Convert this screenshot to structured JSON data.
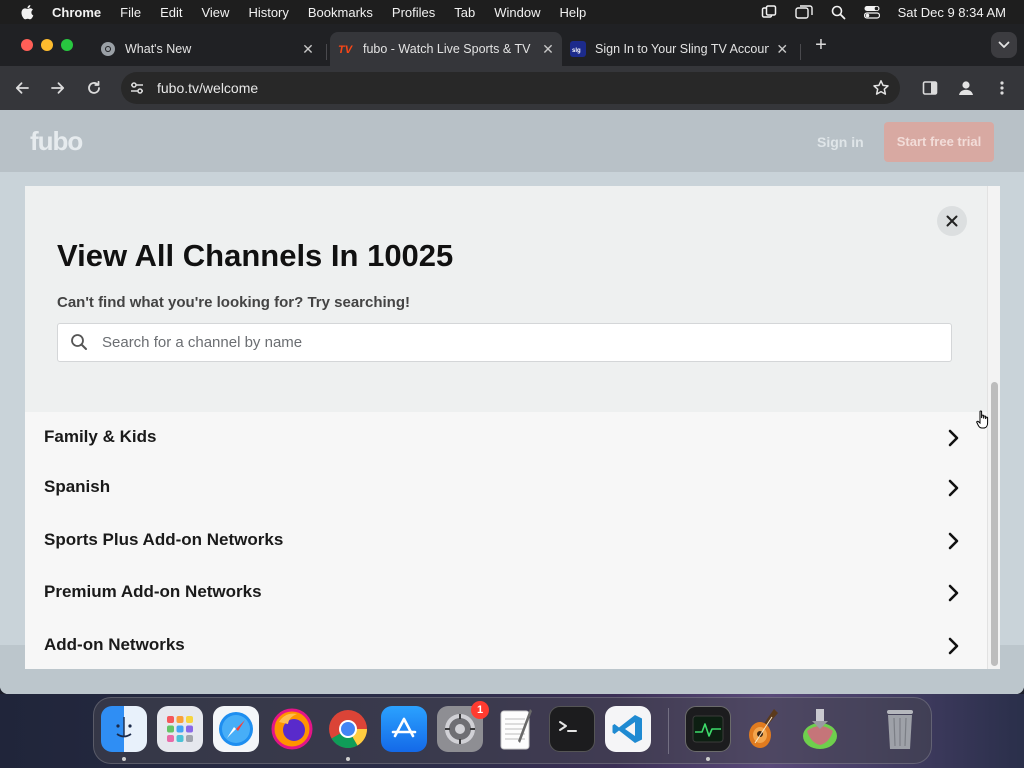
{
  "menubar": {
    "app_name": "Chrome",
    "items": [
      "File",
      "Edit",
      "View",
      "History",
      "Bookmarks",
      "Profiles",
      "Tab",
      "Window",
      "Help"
    ],
    "clock": "Sat Dec 9  8:34 AM"
  },
  "tabs": [
    {
      "title": "What's New",
      "icon": "chrome-icon"
    },
    {
      "title": "fubo - Watch Live Sports & TV",
      "icon": "fubo-tv-icon",
      "active": true
    },
    {
      "title": "Sign In to Your Sling TV Account",
      "icon": "sling-icon"
    }
  ],
  "toolbar": {
    "url": "fubo.tv/welcome"
  },
  "site": {
    "logo": "fubo",
    "sign_in": "Sign in",
    "trial_button": "Start free trial"
  },
  "modal": {
    "title": "View All Channels In 10025",
    "subtitle": "Can't find what you're looking for? Try searching!",
    "search_placeholder": "Search for a channel by name",
    "categories": [
      "Family & Kids",
      "Spanish",
      "Sports Plus Add-on Networks",
      "Premium Add-on Networks",
      "Add-on Networks"
    ]
  },
  "dock": {
    "apps": [
      "finder-icon",
      "launchpad-icon",
      "safari-icon",
      "firefox-icon",
      "chrome-icon",
      "app-store-icon",
      "system-settings-icon",
      "textedit-icon",
      "terminal-icon",
      "vscode-icon",
      "activity-monitor-icon",
      "garageband-icon",
      "archive-utility-icon",
      "trash-icon"
    ],
    "settings_badge": "1"
  },
  "colors": {
    "accent_red": "#fa4616",
    "chrome_dark": "#35363a",
    "modal_bg": "#eef0f0"
  }
}
